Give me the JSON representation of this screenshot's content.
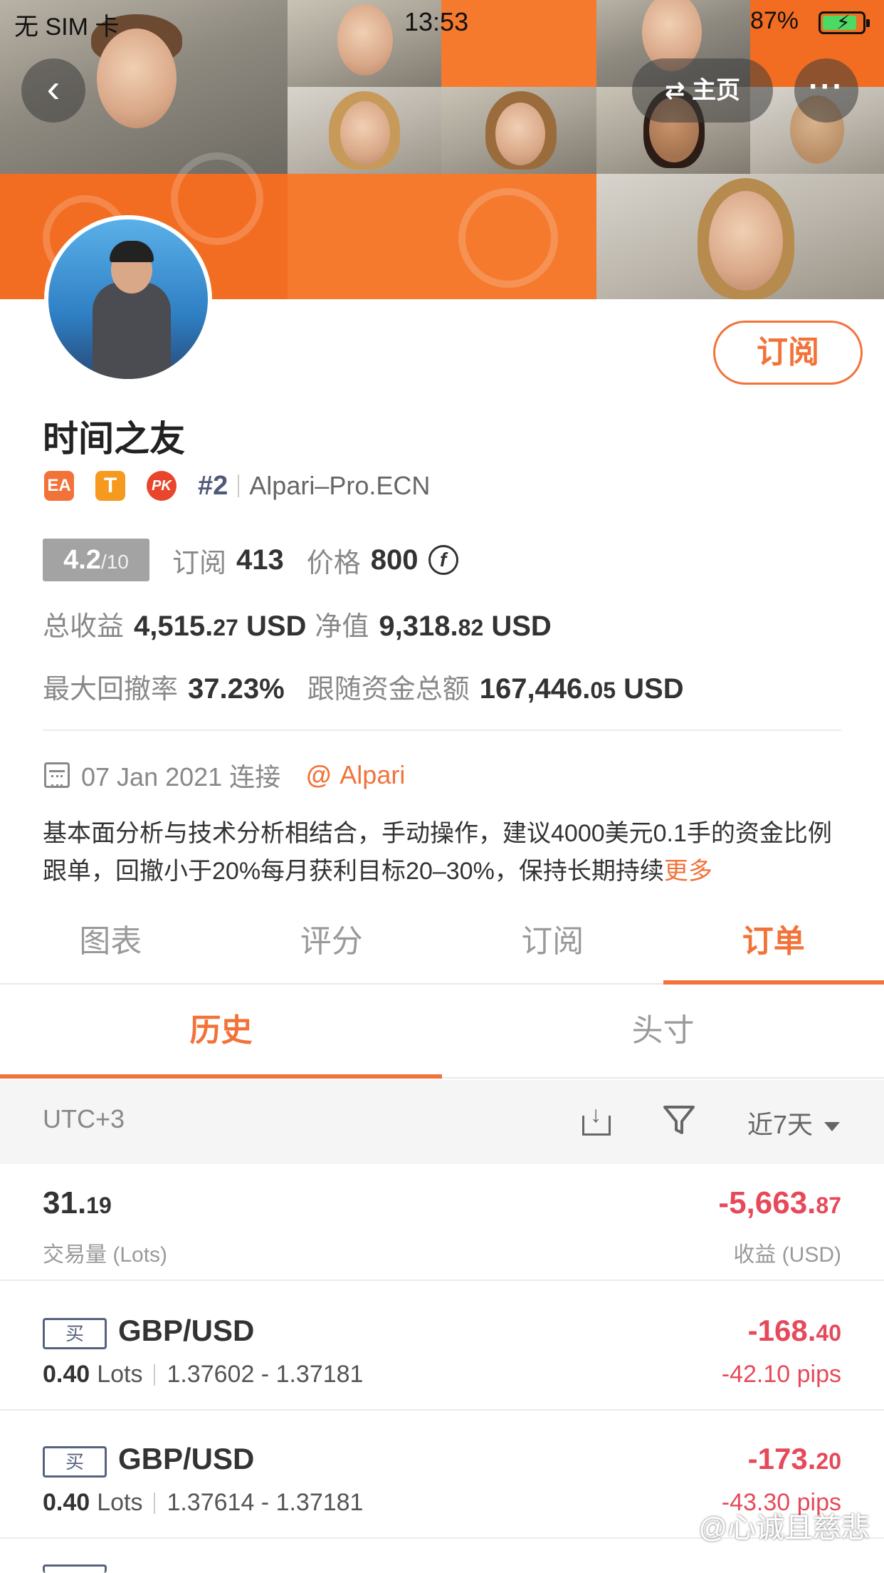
{
  "status_bar": {
    "carrier": "无 SIM 卡",
    "time": "13:53",
    "battery": "87%",
    "battery_level": 0.87
  },
  "nav": {
    "back": "‹",
    "home": "主页",
    "more": "···"
  },
  "profile": {
    "name": "时间之友",
    "subscribe": "订阅",
    "badges": [
      "EA",
      "T",
      "PK"
    ],
    "rank": "#2",
    "broker": "Alpari–Pro.ECN",
    "score": "4.2",
    "score_max": "/10",
    "subscriptions_label": "订阅",
    "subscriptions": "413",
    "price_label": "价格",
    "price": "800",
    "coin_symbol": "f",
    "total_profit_label": "总收益",
    "total_profit_main": "4,515.",
    "total_profit_cents": "27",
    "total_profit_unit": "USD",
    "equity_label": "净值",
    "equity_main": "9,318.",
    "equity_cents": "82",
    "equity_unit": "USD",
    "drawdown_label": "最大回撤率",
    "drawdown": "37.23%",
    "follow_funds_label": "跟随资金总额",
    "follow_funds_main": "167,446.",
    "follow_funds_cents": "05",
    "follow_funds_unit": "USD",
    "connect_date": "07 Jan 2021 连接",
    "at": "@",
    "company": "Alpari",
    "description": "基本面分析与技术分析相结合，手动操作，建议4000美元0.1手的资金比例跟单，回撤小于20%每月获利目标20–30%，保持长期持续",
    "more": "更多"
  },
  "tabs": [
    {
      "label": "图表",
      "active": false
    },
    {
      "label": "评分",
      "active": false
    },
    {
      "label": "订阅",
      "active": false
    },
    {
      "label": "订单",
      "active": true
    }
  ],
  "subtabs": [
    {
      "label": "历史",
      "active": true
    },
    {
      "label": "头寸",
      "active": false
    }
  ],
  "filter": {
    "timezone": "UTC+3",
    "range": "近7天"
  },
  "summary": {
    "lots_main": "31.",
    "lots_cents": "19",
    "lots_label": "交易量 (Lots)",
    "profit_main": "-5,663.",
    "profit_cents": "87",
    "profit_label": "收益 (USD)"
  },
  "trades": [
    {
      "side": "买",
      "pair": "GBP/USD",
      "lots": "0.40",
      "lots_unit": "Lots",
      "prices": "1.37602 - 1.37181",
      "profit_main": "-168.",
      "profit_cents": "40",
      "pips": "-42.10 pips"
    },
    {
      "side": "买",
      "pair": "GBP/USD",
      "lots": "0.40",
      "lots_unit": "Lots",
      "prices": "1.37614 - 1.37181",
      "profit_main": "-173.",
      "profit_cents": "20",
      "pips": "-43.30 pips"
    }
  ],
  "watermark": "@心诚且慈悲",
  "colors": {
    "accent": "#f2733a",
    "negative": "#e64a5a",
    "banner": "#f26d21"
  }
}
